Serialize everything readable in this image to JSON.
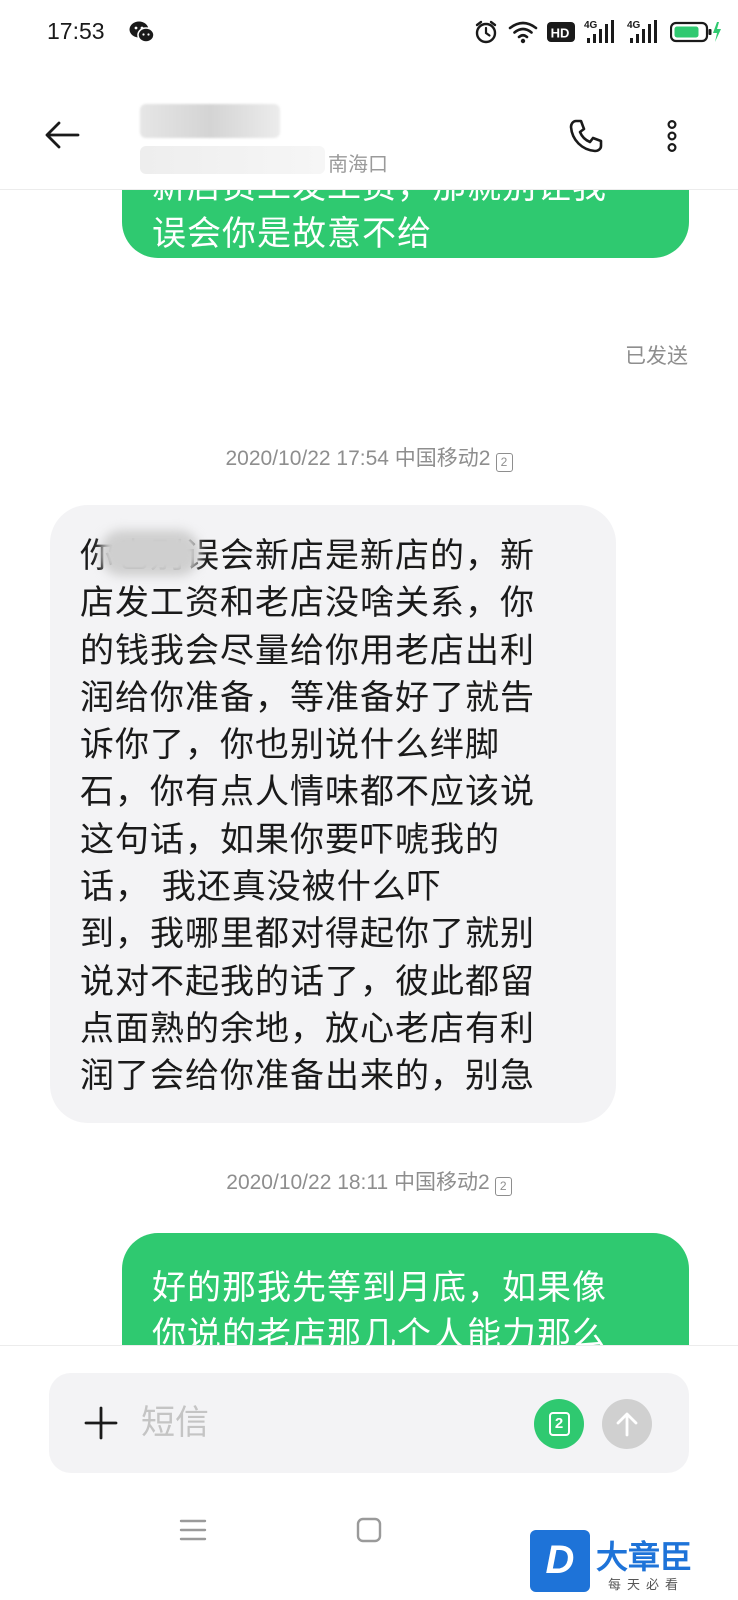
{
  "status_bar": {
    "time": "17:53",
    "icons": [
      "wechat-icon",
      "alarm-icon",
      "wifi-icon",
      "hd-icon",
      "signal-4g-icon",
      "battery-icon"
    ],
    "hd_label": "HD",
    "network_label": "4G"
  },
  "header": {
    "location": "南海口"
  },
  "conversation": {
    "msg1_lines": [
      "新店员工发工资，那就别让我",
      "误会你是故意不给"
    ],
    "sent_status": "已发送",
    "ts1": "2020/10/22 17:54 中国移动2",
    "ts1_sim": "2",
    "msg2_lines": [
      "你也别误会新店是新店的，新",
      "店发工资和老店没啥关系，你",
      "的钱我会尽量给你用老店出利",
      "润给你准备，等准备好了就告",
      "诉你了，你也别说什么绊脚",
      "石，你有点人情味都不应该说",
      "这句话，如果你要吓唬我的",
      "话，    我还真没被什么吓",
      "到，我哪里都对得起你了就别",
      "说对不起我的话了，彼此都留",
      "点面熟的余地，放心老店有利",
      "润了会给你准备出来的，别急"
    ],
    "ts2": "2020/10/22 18:11 中国移动2",
    "ts2_sim": "2",
    "msg3_lines": [
      "好的那我先等到月底，如果像",
      "你说的老店那几个人能力那么"
    ]
  },
  "input": {
    "placeholder": "短信",
    "sim_label": "2"
  },
  "watermark": {
    "logo": "D",
    "name": "大章臣",
    "slogan": "每天必看"
  },
  "colors": {
    "sent_bubble": "#2fc970",
    "received_bubble": "#f3f3f5",
    "meta_text": "#8e8e8e"
  }
}
